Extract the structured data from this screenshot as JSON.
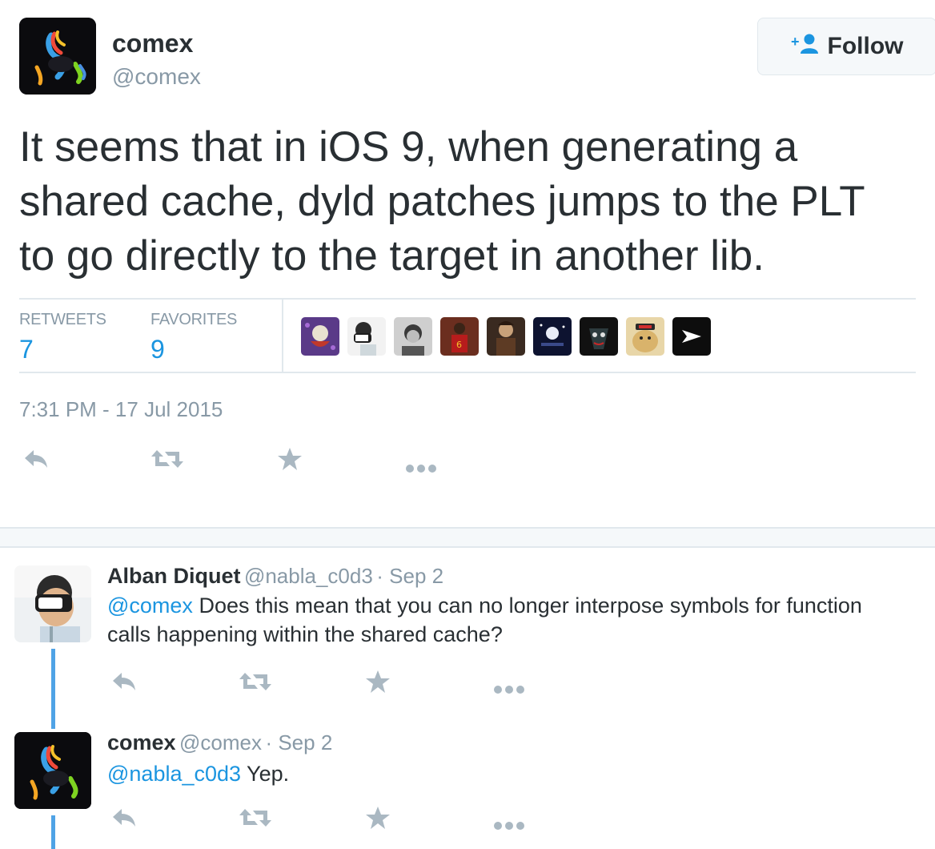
{
  "tweet": {
    "author_name": "comex",
    "author_handle": "@comex",
    "follow_label": "Follow",
    "text_lines": [
      "It seems that in iOS 9, when generating a",
      "shared cache, dyld patches jumps to the PLT",
      "to go directly to the target in another lib."
    ],
    "retweets_label": "RETWEETS",
    "retweets_count": "7",
    "favorites_label": "FAVORITES",
    "favorites_count": "9",
    "favoriters_count_shown": 9,
    "timestamp": "7:31 PM - 17 Jul 2015"
  },
  "replies": [
    {
      "name": "Alban Diquet",
      "handle": "@nabla_c0d3",
      "date": "· Sep 2",
      "mention": "@comex",
      "text_line1": " Does this mean that you can no longer interpose symbols for function",
      "text_line2": "calls happening within the shared cache?"
    },
    {
      "name": "comex",
      "handle": "@comex",
      "date": "· Sep 2",
      "mention": "@nabla_c0d3",
      "text_line1": " Yep."
    }
  ],
  "icons": {
    "reply": "reply-icon",
    "retweet": "retweet-icon",
    "favorite": "star-icon",
    "more": "more-icon",
    "follow": "add-user-icon"
  },
  "colors": {
    "link": "#1b95e0",
    "muted": "#8899a6",
    "action": "#aab8c2",
    "thread": "#4fa3e6"
  }
}
